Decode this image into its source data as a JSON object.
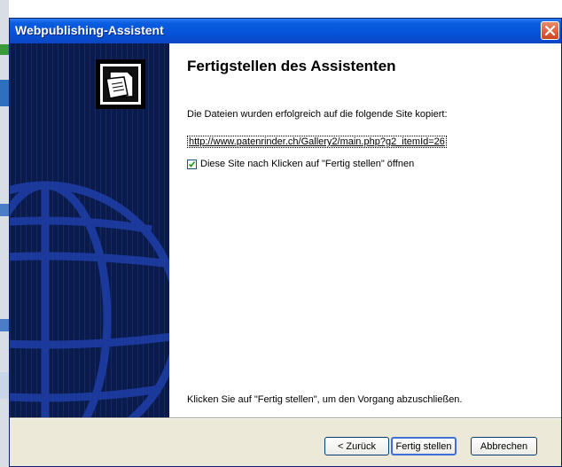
{
  "window": {
    "title": "Webpublishing-Assistent"
  },
  "content": {
    "heading": "Fertigstellen des Assistenten",
    "info_text": "Die Dateien wurden erfolgreich auf die folgende Site kopiert:",
    "site_link": "http://www.patenrinder.ch/Gallery2/main.php?g2_itemId=26",
    "open_checkbox": {
      "label": "Diese Site nach Klicken auf \"Fertig stellen\" öffnen",
      "checked": true
    },
    "finish_hint": "Klicken Sie auf \"Fertig stellen\", um den Vorgang abzuschließen."
  },
  "buttons": {
    "back": "< Zurück",
    "finish": "Fertig stellen",
    "cancel": "Abbrechen"
  },
  "icons": [
    "close-icon",
    "wizard-icon",
    "globe-icon",
    "checkmark-icon"
  ],
  "colors": {
    "titlebar": "#0552d8",
    "left_panel": "#0a1a4a",
    "dialog_bg": "#ece9d8"
  }
}
